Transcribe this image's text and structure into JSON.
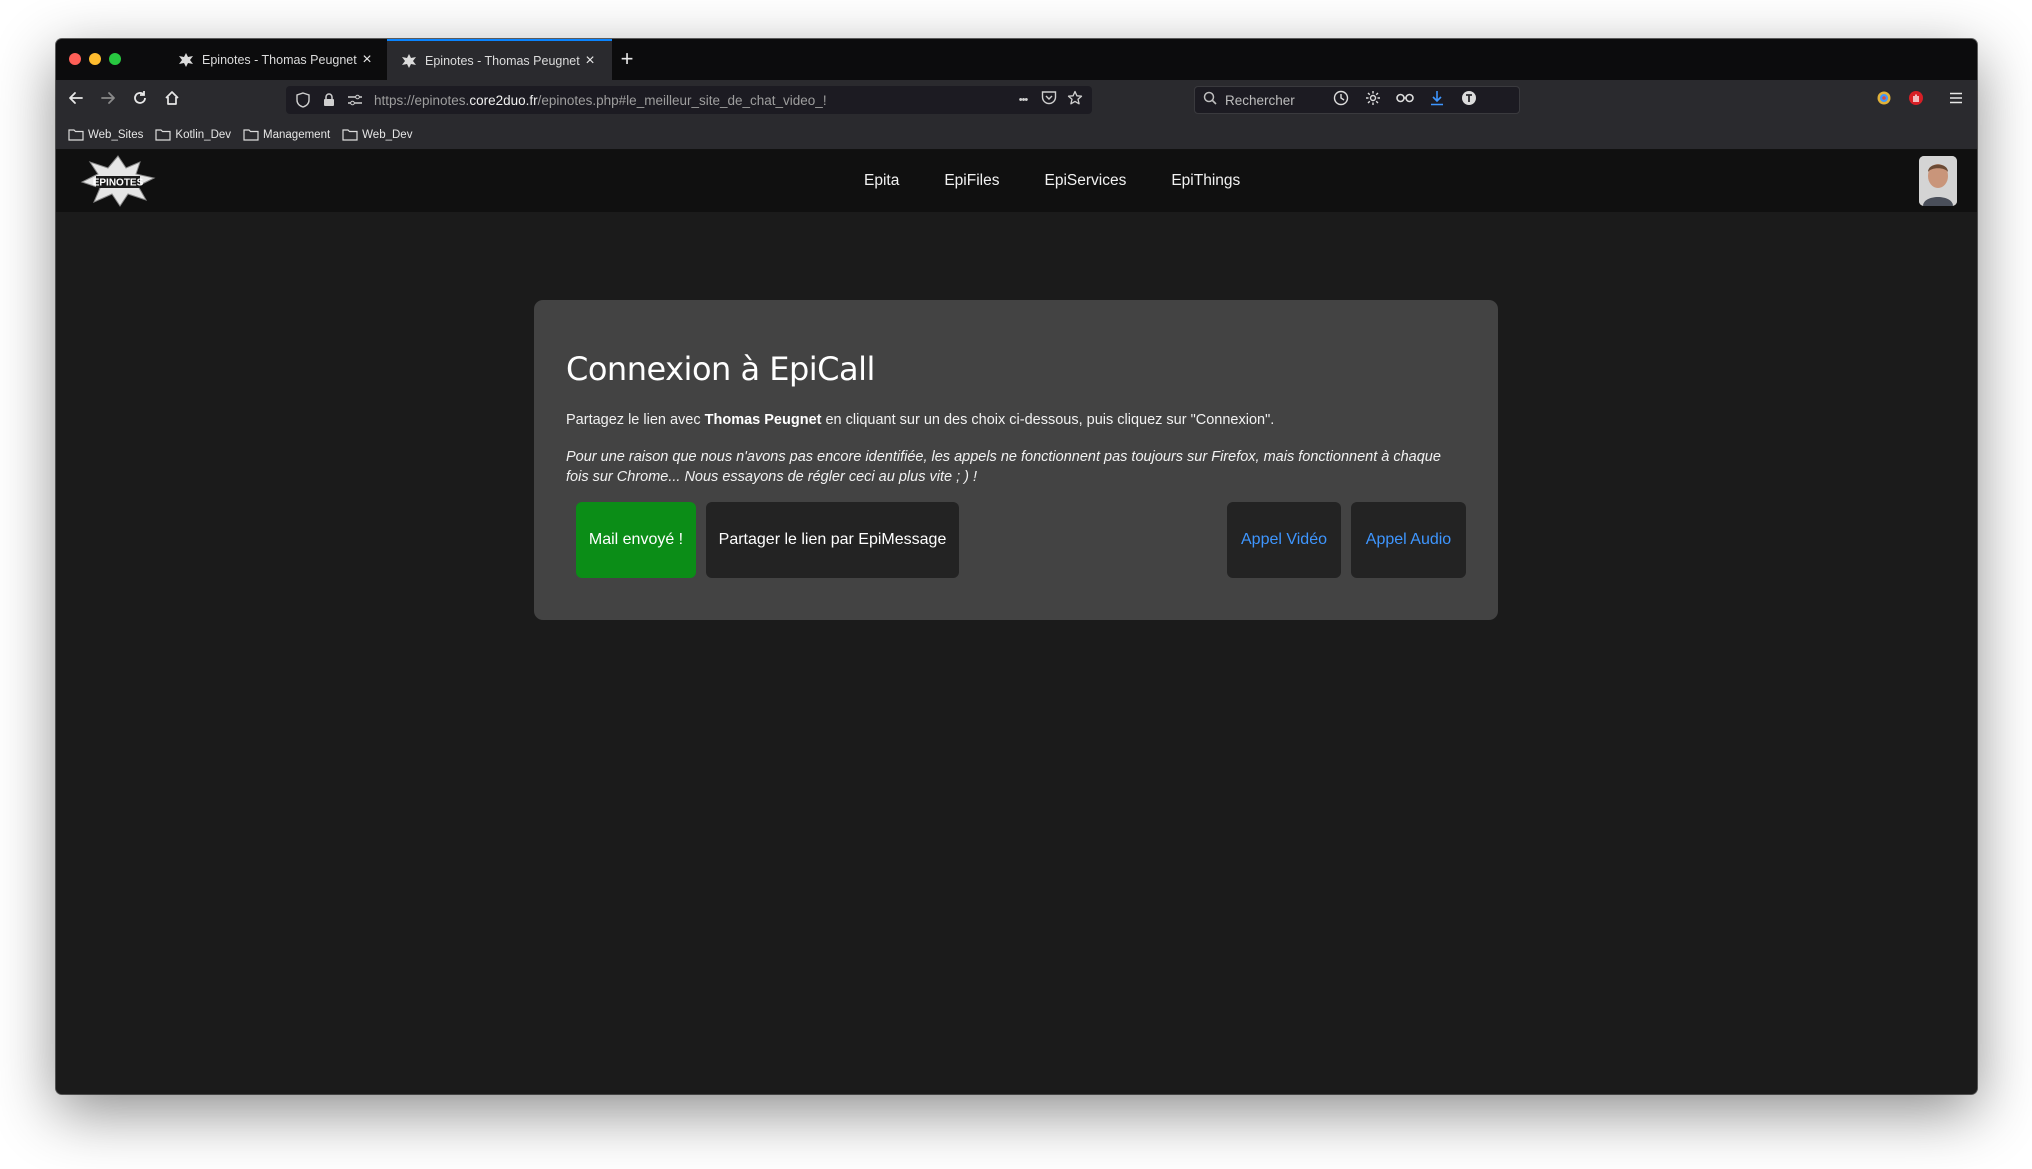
{
  "browser": {
    "tabs": [
      {
        "title": "Epinotes - Thomas Peugnet",
        "active": false
      },
      {
        "title": "Epinotes - Thomas Peugnet",
        "active": true
      }
    ],
    "new_tab_label": "+",
    "close_glyph": "×",
    "url": {
      "prefix": "https://epinotes.",
      "host": "core2duo.fr",
      "path": "/epinotes.php#le_meilleur_site_de_chat_video_!"
    },
    "url_more_label": "•••",
    "search_placeholder": "Rechercher",
    "bookmarks": [
      "Web_Sites",
      "Kotlin_Dev",
      "Management",
      "Web_Dev"
    ],
    "accent_color": "#0a84ff"
  },
  "site": {
    "logo_text": "EPINOTES",
    "menu": [
      "Epita",
      "EpiFiles",
      "EpiServices",
      "EpiThings"
    ]
  },
  "modal": {
    "title": "Connexion à EpiCall",
    "intro_before": "Partagez le lien avec ",
    "intro_name": "Thomas Peugnet",
    "intro_after": " en cliquant sur un des choix ci-dessous, puis cliquez sur \"Connexion\".",
    "warning": "Pour une raison que nous n'avons pas encore identifiée, les appels ne fonctionnent pas toujours sur Firefox, mais fonctionnent à chaque fois sur Chrome... Nous essayons de régler ceci au plus vite ; ) !",
    "buttons": {
      "mail": "Mail envoyé !",
      "share": "Partager le lien par EpiMessage",
      "video": "Appel Vidéo",
      "audio": "Appel Audio"
    },
    "colors": {
      "success": "#0b8d17",
      "link": "#3e96ff"
    }
  }
}
